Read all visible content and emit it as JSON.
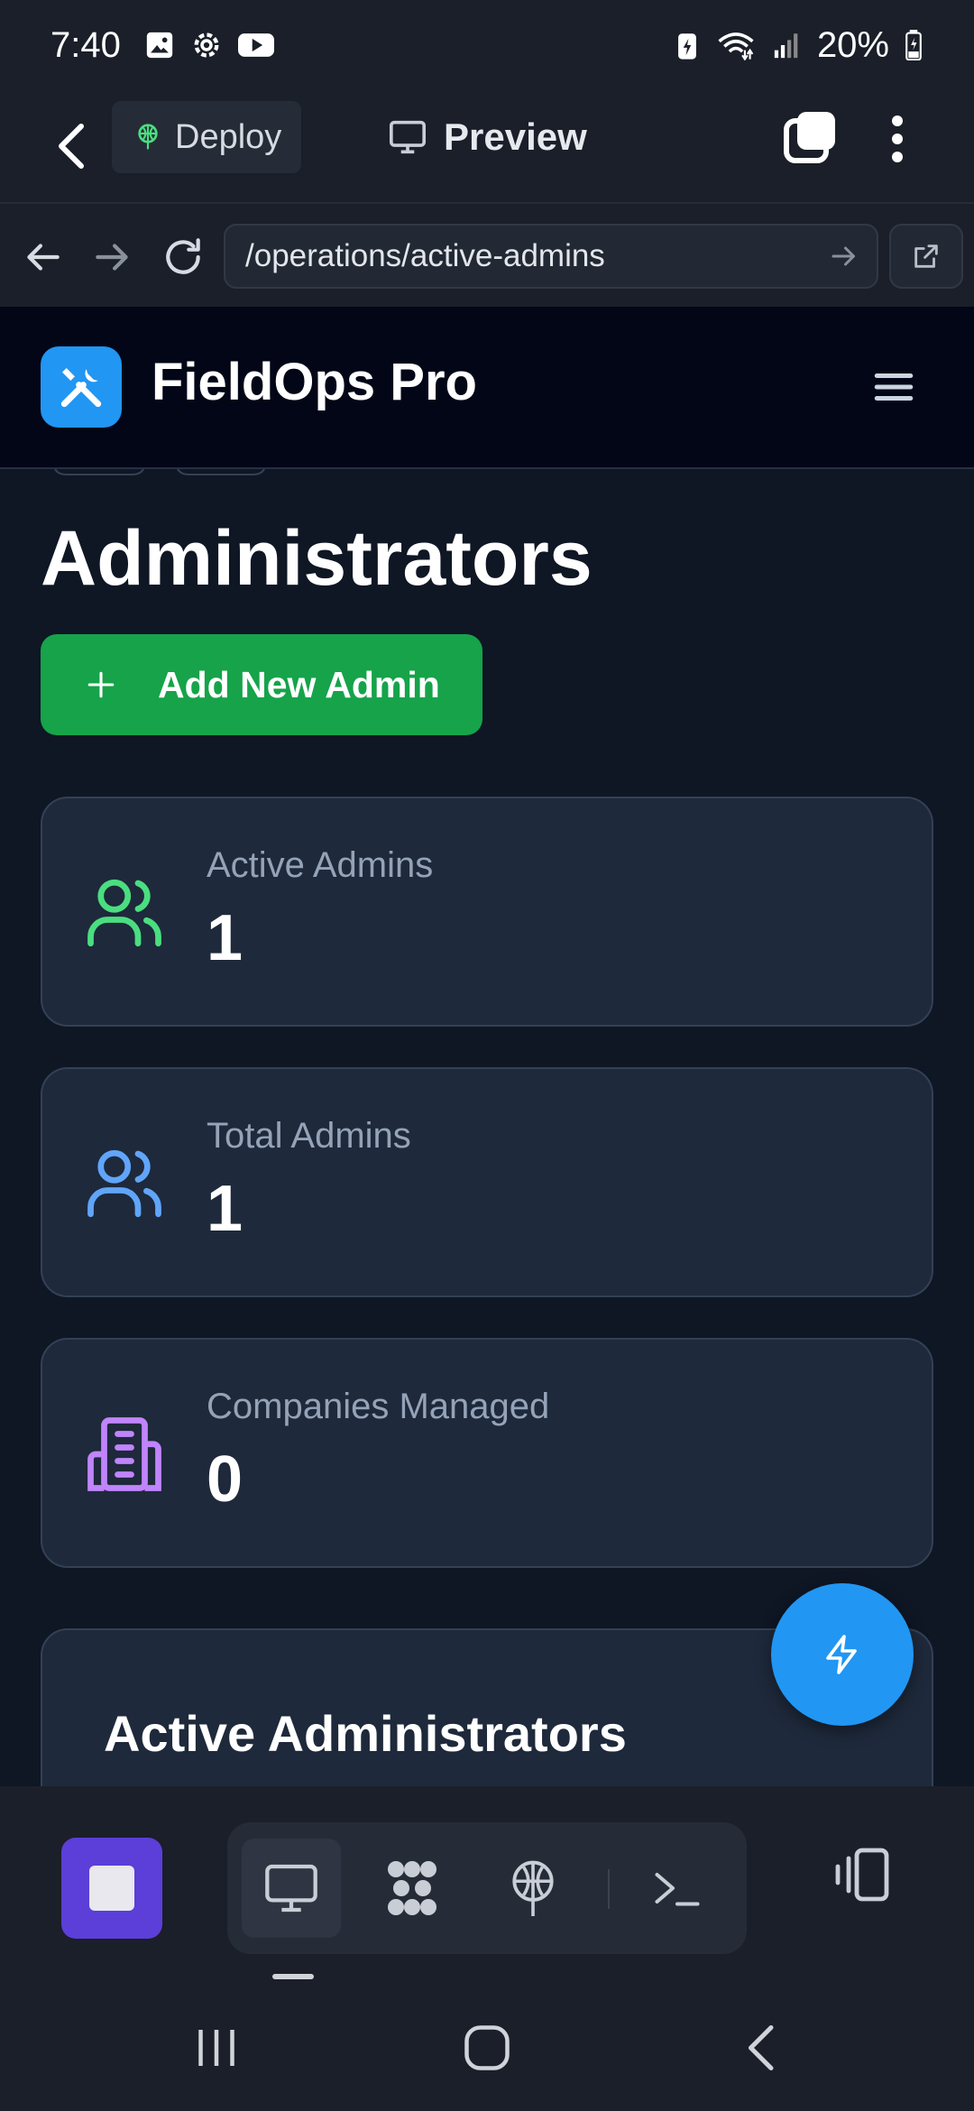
{
  "status_bar": {
    "time": "7:40",
    "battery": "20%",
    "icons": [
      "gallery-icon",
      "settings-icon",
      "youtube-icon",
      "battery-saver-icon",
      "wifi-icon",
      "signal-icon",
      "battery-icon"
    ]
  },
  "app_bar": {
    "deploy_label": "Deploy",
    "preview_label": "Preview"
  },
  "url_bar": {
    "url": "/operations/active-admins"
  },
  "web_header": {
    "brand": "FieldOps Pro"
  },
  "page": {
    "title": "Administrators",
    "add_button_label": "Add New Admin"
  },
  "stats": [
    {
      "label": "Active Admins",
      "value": "1",
      "icon": "users-icon",
      "color": "#4ade80"
    },
    {
      "label": "Total Admins",
      "value": "1",
      "icon": "users-icon",
      "color": "#60a5fa"
    },
    {
      "label": "Companies Managed",
      "value": "0",
      "icon": "building-icon",
      "color": "#c084fc"
    }
  ],
  "section": {
    "title": "Active Administrators"
  },
  "colors": {
    "accent_blue": "#2196f3",
    "add_green": "#16a34a",
    "stop_purple": "#5b3fd8",
    "card_bg": "#1e293b"
  }
}
